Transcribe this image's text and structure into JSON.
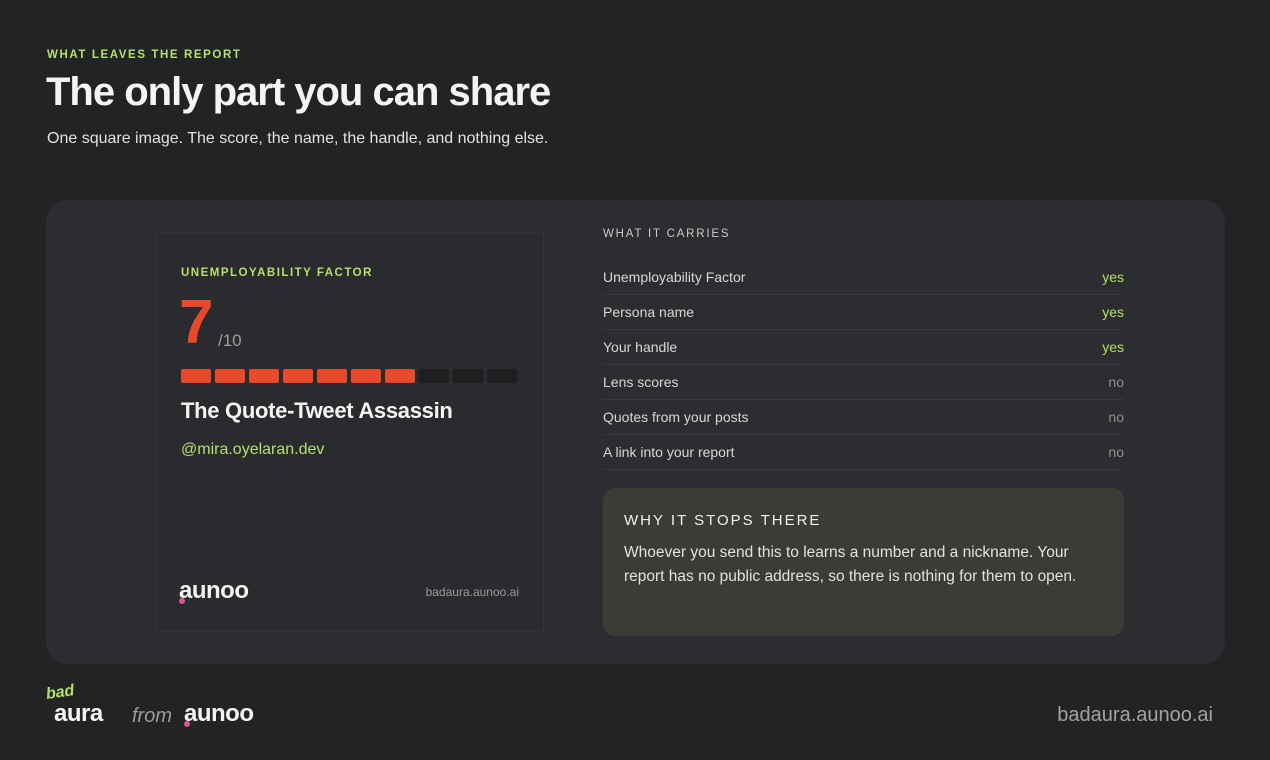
{
  "header": {
    "eyebrow": "WHAT LEAVES THE REPORT",
    "title": "The only part you can share",
    "subtitle": "One square image. The score, the name, the handle, and nothing else."
  },
  "share_card": {
    "label": "UNEMPLOYABILITY FACTOR",
    "score": "7",
    "score_max": "/10",
    "meter": {
      "filled": 7,
      "total": 10
    },
    "persona": "The Quote-Tweet Assassin",
    "handle": "@mira.oyelaran.dev",
    "logo": "aunoo",
    "url": "badaura.aunoo.ai"
  },
  "carries": {
    "heading": "WHAT IT CARRIES",
    "rows": [
      {
        "label": "Unemployability Factor",
        "value": "yes"
      },
      {
        "label": "Persona name",
        "value": "yes"
      },
      {
        "label": "Your handle",
        "value": "yes"
      },
      {
        "label": "Lens scores",
        "value": "no"
      },
      {
        "label": "Quotes from your posts",
        "value": "no"
      },
      {
        "label": "A link into your report",
        "value": "no"
      }
    ]
  },
  "why": {
    "heading": "WHY IT STOPS THERE",
    "body": "Whoever you send this to learns a number and a nickname. Your report has no public address, so there is nothing for them to open."
  },
  "footer": {
    "bad": "bad",
    "aura": "aura",
    "from": "from",
    "aunoo": "aunoo",
    "url": "badaura.aunoo.ai"
  },
  "colors": {
    "accent_green": "#b5e06a",
    "accent_red": "#e8492c",
    "brand_pink": "#d9579b",
    "background": "#222325"
  }
}
